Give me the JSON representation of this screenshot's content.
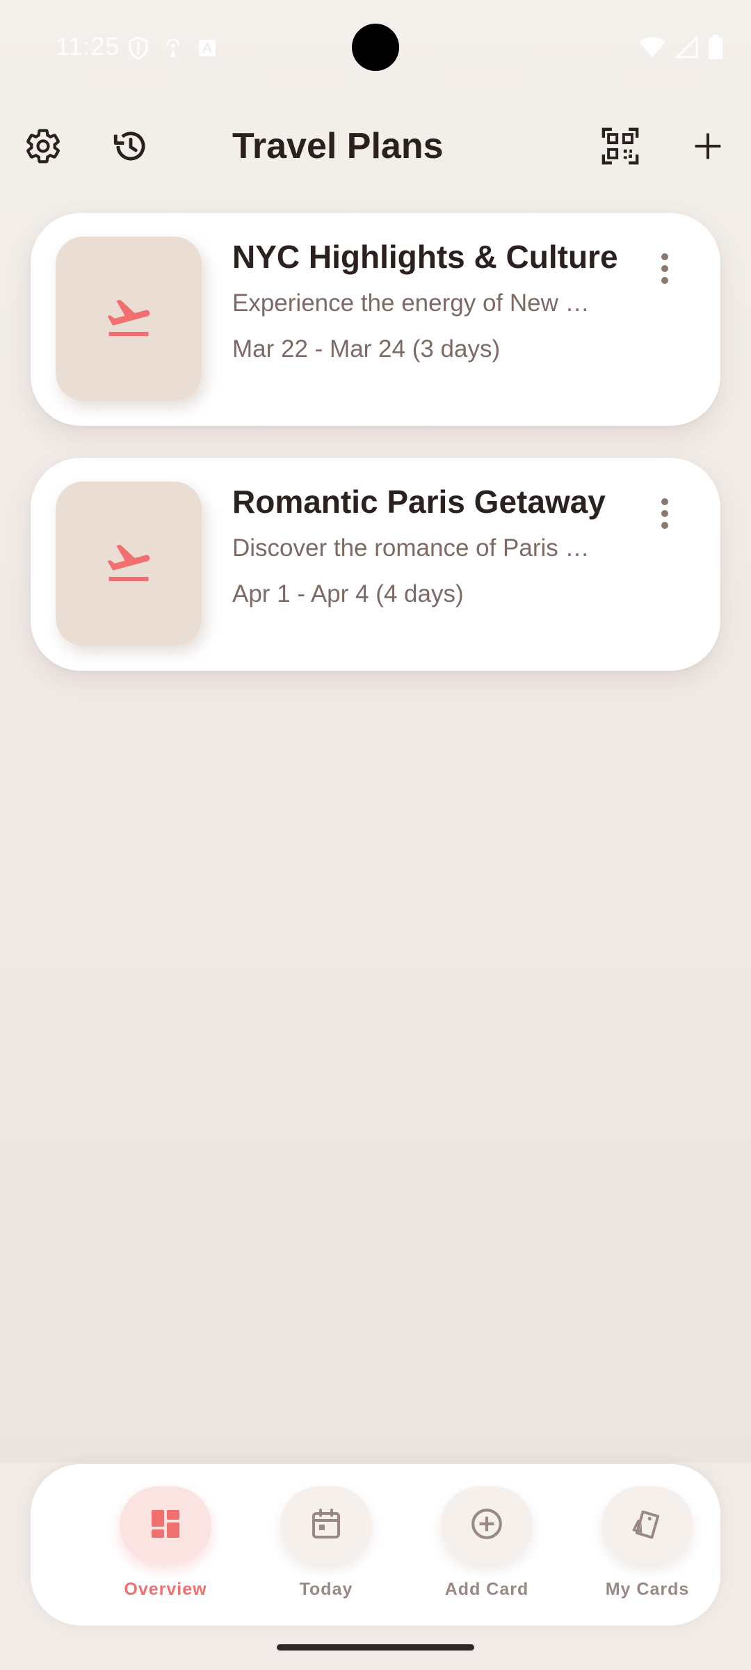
{
  "status_bar": {
    "time": "11:25",
    "left_icons": [
      "shield-icon",
      "fingerprint-icon",
      "font-a-icon"
    ],
    "right_icons": [
      "wifi-icon",
      "signal-icon",
      "battery-icon"
    ]
  },
  "header": {
    "title": "Travel Plans",
    "left_icons": [
      "gear-icon",
      "history-icon"
    ],
    "right_icons": [
      "qr-code-icon",
      "plus-icon"
    ]
  },
  "trips": [
    {
      "title": "NYC Highlights & Culture",
      "description": "Experience the energy of New …",
      "dates": "Mar 22 - Mar 24 (3 days)",
      "icon": "airplane-takeoff-icon"
    },
    {
      "title": "Romantic Paris Getaway",
      "description": "Discover the romance of Paris …",
      "dates": "Apr 1 - Apr 4 (4 days)",
      "icon": "airplane-takeoff-icon"
    }
  ],
  "bottom_nav": {
    "items": [
      {
        "label": "Overview",
        "icon": "dashboard-icon",
        "active": true
      },
      {
        "label": "Today",
        "icon": "calendar-icon",
        "active": false
      },
      {
        "label": "Add Card",
        "icon": "add-circle-icon",
        "active": false
      },
      {
        "label": "My Cards",
        "icon": "cards-icon",
        "active": false
      }
    ]
  },
  "colors": {
    "accent": "#f07070",
    "background": "#f1ebe7",
    "text_primary": "#2a211e",
    "text_secondary": "#7d6a63",
    "thumb_bg": "#e9ddd4"
  }
}
